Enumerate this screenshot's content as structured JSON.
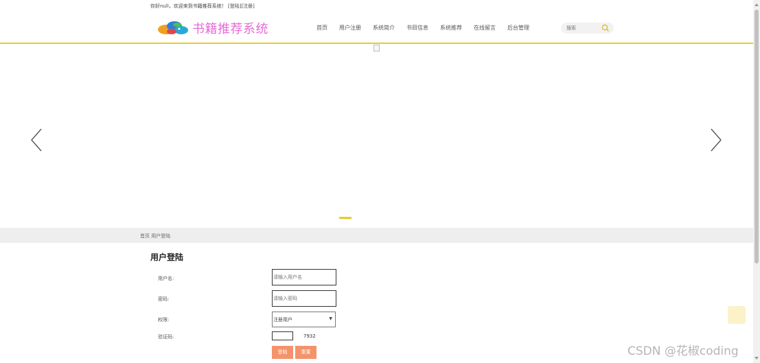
{
  "header": {
    "welcome_text": "你好null，欢迎来到书籍推荐系统！ [登陆][注册]",
    "site_title": "书籍推荐系统"
  },
  "nav": {
    "items": [
      {
        "label": "首页"
      },
      {
        "label": "用户注册"
      },
      {
        "label": "系统简介"
      },
      {
        "label": "书目信息"
      },
      {
        "label": "系统推荐"
      },
      {
        "label": "在线留言"
      },
      {
        "label": "后台管理"
      }
    ],
    "search_placeholder": "搜索"
  },
  "breadcrumb": {
    "text": "首页 用户登陆"
  },
  "form": {
    "title": "用户登陆",
    "username_label": "用户名:",
    "username_placeholder": "请输入用户名",
    "password_label": "密码:",
    "password_placeholder": "请输入密码",
    "role_label": "权限:",
    "role_value": "注册用户",
    "captcha_label": "验证码:",
    "captcha_code": "7932",
    "login_button": "登陆",
    "reset_button": "重置"
  },
  "watermark": "CSDN @花椒coding",
  "colors": {
    "accent_yellow": "#e5cc2a",
    "button_orange": "#f4936b",
    "title_pink": "#e86ad8"
  }
}
